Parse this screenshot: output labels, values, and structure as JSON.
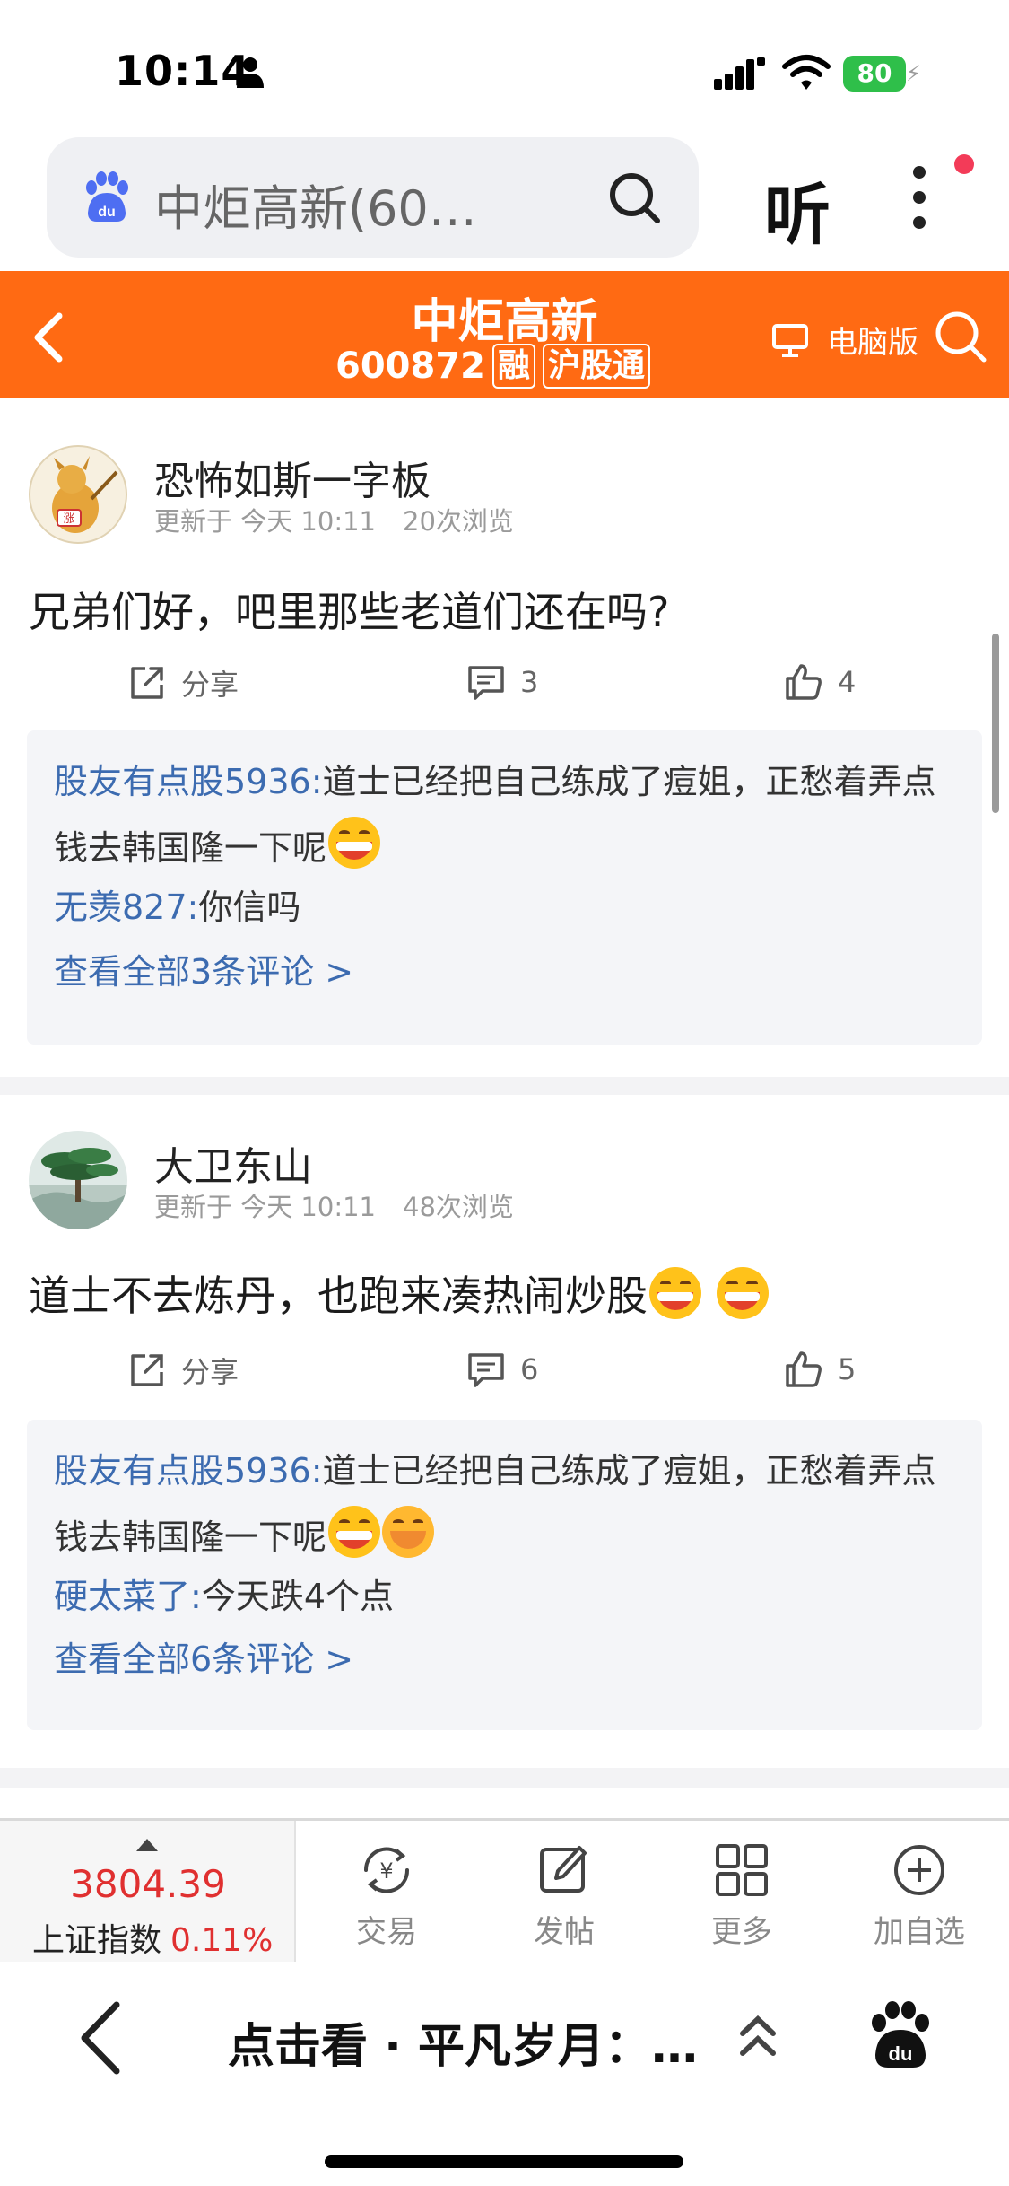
{
  "status_bar": {
    "time": "10:14",
    "battery": "80"
  },
  "search": {
    "query": "中炬高新(60…"
  },
  "toolbar": {
    "listen_label": "听"
  },
  "header": {
    "stock_name": "中炬高新",
    "stock_code": "600872",
    "tag_margin": "融",
    "tag_connect": "沪股通",
    "pc_label": "电脑版"
  },
  "posts": [
    {
      "author": "恐怖如斯一字板",
      "updated": "更新于 今天 10:11",
      "views": "20次浏览",
      "text": "兄弟们好，吧里那些老道们还在吗?",
      "share_label": "分享",
      "comment_count": "3",
      "like_count": "4",
      "comments": [
        {
          "user": "股友有点股5936:",
          "text_line1": "道士已经把自己练成了痘姐，正愁着弄点",
          "text_line2": "钱去韩国隆一下呢"
        },
        {
          "user": "无羡827:",
          "text_line1": "你信吗"
        }
      ],
      "view_all": "查看全部3条评论 >"
    },
    {
      "author": "大卫东山",
      "updated": "更新于 今天 10:11",
      "views": "48次浏览",
      "text": "道士不去炼丹，也跑来凑热闹炒股",
      "share_label": "分享",
      "comment_count": "6",
      "like_count": "5",
      "comments": [
        {
          "user": "股友有点股5936:",
          "text_line1": "道士已经把自己练成了痘姐，正愁着弄点",
          "text_line2": "钱去韩国隆一下呢"
        },
        {
          "user": "硬太菜了:",
          "text_line1": "今天跌4个点"
        }
      ],
      "view_all": "查看全部6条评论 >"
    }
  ],
  "stock_bar": {
    "index_value": "3804.39",
    "index_name": "上证指数",
    "index_change": "0.11%",
    "tools": [
      "交易",
      "发帖",
      "更多",
      "加自选"
    ]
  },
  "browser_bar": {
    "title": "点击看 · 平凡岁月：…"
  },
  "colors": {
    "accent": "#ff6a13",
    "link": "#3c6bb0",
    "up": "#e03030"
  }
}
